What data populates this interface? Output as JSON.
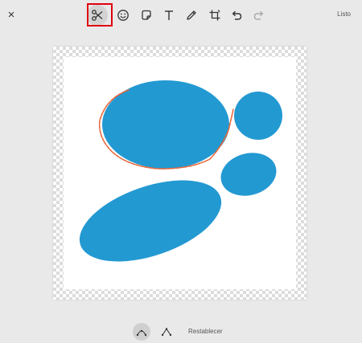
{
  "toolbar": {
    "close_icon": "×",
    "done_label": "Listo",
    "tools": [
      {
        "name": "scissors-icon",
        "selected": true
      },
      {
        "name": "emoji-icon",
        "selected": false
      },
      {
        "name": "sticker-icon",
        "selected": false
      },
      {
        "name": "text-icon",
        "selected": false
      },
      {
        "name": "pencil-icon",
        "selected": false
      },
      {
        "name": "crop-rotate-icon",
        "selected": false
      },
      {
        "name": "undo-icon",
        "selected": false
      },
      {
        "name": "redo-icon",
        "selected": false
      }
    ],
    "highlight_color": "#e1000f"
  },
  "canvas": {
    "shape_color": "#2399d2",
    "selection_color": "#e8663a"
  },
  "bottom_bar": {
    "modes": [
      {
        "name": "curved-lasso-icon",
        "selected": true
      },
      {
        "name": "polygon-lasso-icon",
        "selected": false
      }
    ],
    "reset_label": "Restablecer"
  }
}
